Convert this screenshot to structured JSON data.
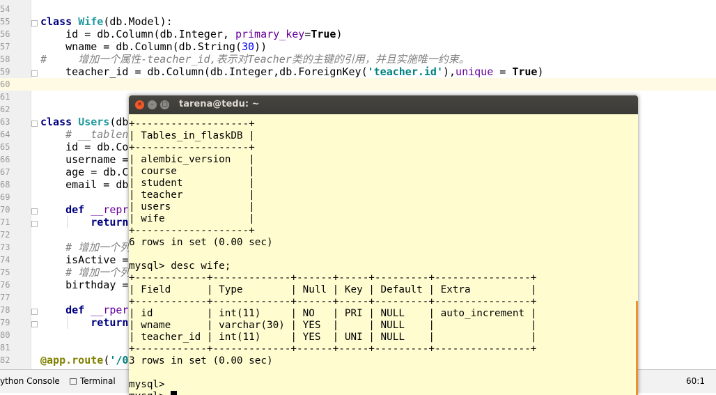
{
  "editor": {
    "lines": [
      {
        "n": "54",
        "segs": []
      },
      {
        "n": "55",
        "segs": [
          {
            "t": "class ",
            "c": "kw"
          },
          {
            "t": "Wife",
            "c": "cls"
          },
          {
            "t": "(db.Model):"
          }
        ]
      },
      {
        "n": "56",
        "segs": [
          {
            "t": "    id = db.Column(db.Integer, "
          },
          {
            "t": "primary_key",
            "c": "param"
          },
          {
            "t": "="
          },
          {
            "t": "True",
            "c": "bold"
          },
          {
            "t": ")"
          }
        ]
      },
      {
        "n": "57",
        "segs": [
          {
            "t": "    wname = db.Column(db.String("
          },
          {
            "t": "30",
            "c": "num"
          },
          {
            "t": "))"
          }
        ]
      },
      {
        "n": "58",
        "segs": [
          {
            "t": "#     增加一个属性-teacher_id,表示对Teacher类的主键的引用，并且实施唯一约束。",
            "c": "comment"
          }
        ]
      },
      {
        "n": "59",
        "segs": [
          {
            "t": "    teacher_id = db.Column(db.Integer,db.ForeignKey("
          },
          {
            "t": "'teacher.id'",
            "c": "str"
          },
          {
            "t": "),"
          },
          {
            "t": "unique",
            "c": "param"
          },
          {
            "t": " = "
          },
          {
            "t": "True",
            "c": "bold"
          },
          {
            "t": ")"
          }
        ]
      },
      {
        "n": "60",
        "segs": [],
        "current": true
      },
      {
        "n": "61",
        "segs": []
      },
      {
        "n": "62",
        "segs": []
      },
      {
        "n": "63",
        "segs": [
          {
            "t": "class ",
            "c": "kw"
          },
          {
            "t": "Users",
            "c": "cls"
          },
          {
            "t": "(db"
          }
        ]
      },
      {
        "n": "64",
        "segs": [
          {
            "t": "    # __tablen",
            "c": "comment"
          }
        ]
      },
      {
        "n": "65",
        "segs": [
          {
            "t": "    id = db.Co"
          }
        ]
      },
      {
        "n": "66",
        "segs": [
          {
            "t": "    username ="
          }
        ]
      },
      {
        "n": "67",
        "segs": [
          {
            "t": "    age = db.C"
          }
        ]
      },
      {
        "n": "68",
        "segs": [
          {
            "t": "    email = db"
          }
        ]
      },
      {
        "n": "69",
        "segs": []
      },
      {
        "n": "70",
        "segs": [
          {
            "t": "    "
          },
          {
            "t": "def ",
            "c": "kw"
          },
          {
            "t": "__repr",
            "c": "param"
          }
        ]
      },
      {
        "n": "71",
        "segs": [
          {
            "t": "        "
          },
          {
            "t": "return",
            "c": "kw"
          }
        ]
      },
      {
        "n": "72",
        "segs": []
      },
      {
        "n": "73",
        "segs": [
          {
            "t": "    # 增加一个列",
            "c": "comment"
          }
        ]
      },
      {
        "n": "74",
        "segs": [
          {
            "t": "    isActive ="
          }
        ]
      },
      {
        "n": "75",
        "segs": [
          {
            "t": "    # 增加一个列",
            "c": "comment"
          }
        ]
      },
      {
        "n": "76",
        "segs": [
          {
            "t": "    birthday ="
          }
        ]
      },
      {
        "n": "77",
        "segs": []
      },
      {
        "n": "78",
        "segs": [
          {
            "t": "    "
          },
          {
            "t": "def ",
            "c": "kw"
          },
          {
            "t": "__rper",
            "c": "param"
          }
        ]
      },
      {
        "n": "79",
        "segs": [
          {
            "t": "        "
          },
          {
            "t": "return",
            "c": "kw"
          }
        ]
      },
      {
        "n": "80",
        "segs": []
      },
      {
        "n": "81",
        "segs": []
      },
      {
        "n": "82",
        "segs": [
          {
            "t": "@app.route",
            "c": "deco"
          },
          {
            "t": "("
          },
          {
            "t": "'/0",
            "c": "str"
          }
        ]
      }
    ]
  },
  "statusbar": {
    "python_console": "ython Console",
    "terminal": "Terminal",
    "position": "60:1"
  },
  "terminal": {
    "title": "tarena@tedu: ~",
    "buttons": {
      "close": "×",
      "minimize": "–",
      "maximize": "□"
    },
    "lines": [
      "+-------------------+",
      "| Tables_in_flaskDB |",
      "+-------------------+",
      "| alembic_version   |",
      "| course            |",
      "| student           |",
      "| teacher           |",
      "| users             |",
      "| wife              |",
      "+-------------------+",
      "6 rows in set (0.00 sec)",
      "",
      "mysql> desc wife;",
      "+------------+-------------+------+-----+---------+----------------+",
      "| Field      | Type        | Null | Key | Default | Extra          |",
      "+------------+-------------+------+-----+---------+----------------+",
      "| id         | int(11)     | NO   | PRI | NULL    | auto_increment |",
      "| wname      | varchar(30) | YES  |     | NULL    |                |",
      "| teacher_id | int(11)     | YES  | UNI | NULL    |                |",
      "+------------+-------------+------+-----+---------+----------------+",
      "3 rows in set (0.00 sec)",
      "",
      "mysql> ",
      "mysql> "
    ]
  }
}
